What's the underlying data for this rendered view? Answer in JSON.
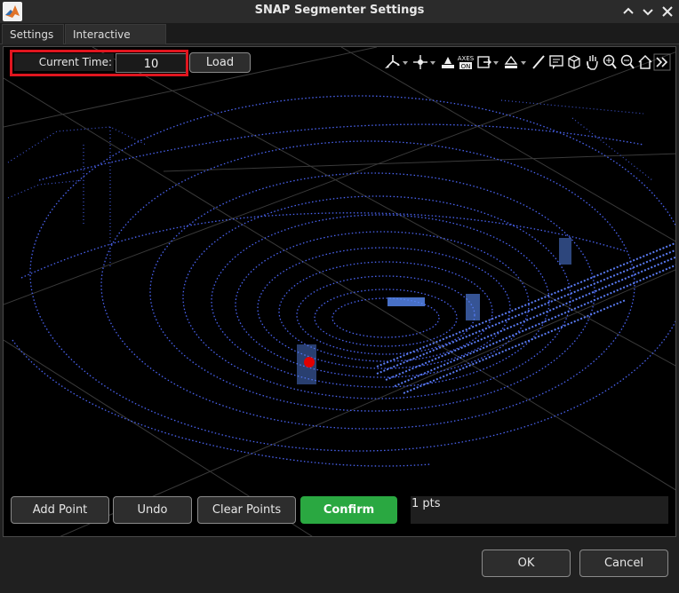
{
  "window": {
    "title": "SNAP Segmenter Settings",
    "app_icon": "matlab-logo-icon",
    "controls": [
      "maximize-icon",
      "restore-icon",
      "close-icon"
    ]
  },
  "tabs": [
    {
      "label": "Settings",
      "active": false
    },
    {
      "label": "Interactive Picker",
      "active": true
    }
  ],
  "picker": {
    "time_label": "Current Time:",
    "time_value": "10",
    "load_label": "Load",
    "highlight_color": "#e0161f",
    "toolbar_icons": [
      "data-tips-icon",
      "rotate-icon",
      "brush-icon",
      "axes-on-icon",
      "export-icon",
      "paint-icon",
      "pencil-icon",
      "annotate-icon",
      "3d-box-icon",
      "pan-icon",
      "zoom-in-icon",
      "zoom-out-icon",
      "home-icon",
      "more-icon"
    ],
    "toolbar_axes_text": "AXES ON",
    "point_color": "#e00000",
    "point_cloud_color": "#4a63f0"
  },
  "actions": {
    "add_point_label": "Add Point",
    "undo_label": "Undo",
    "clear_points_label": "Clear Points",
    "confirm_label": "Confirm",
    "confirm_color": "#2aa841",
    "pts_text": "1 pts"
  },
  "footer": {
    "ok_label": "OK",
    "cancel_label": "Cancel"
  }
}
